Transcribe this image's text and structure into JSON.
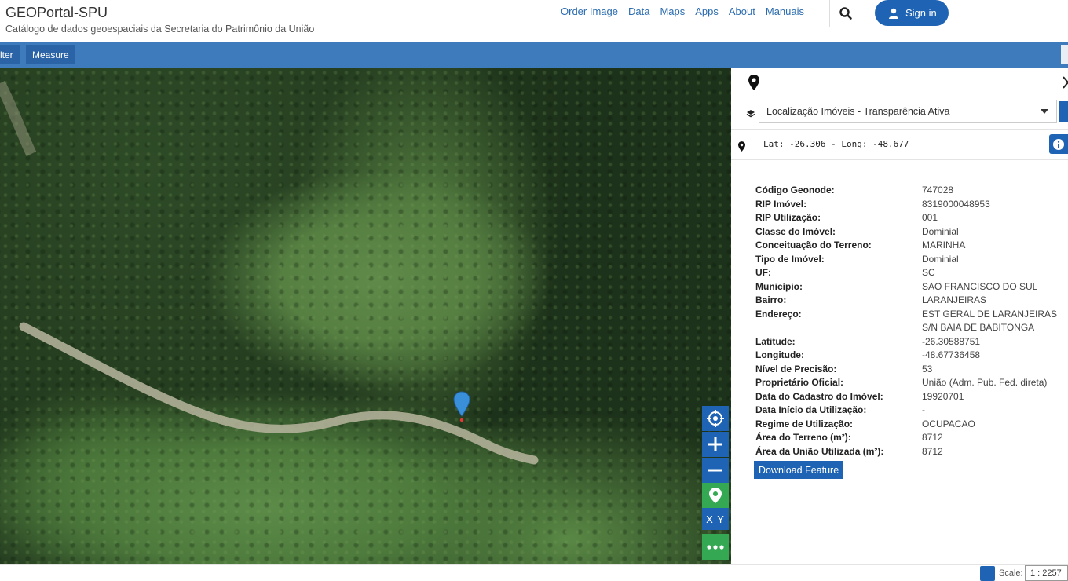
{
  "header": {
    "title": "GEOPortal-SPU",
    "subtitle": "Catálogo de dados geoespaciais da Secretaria do Patrimônio da União",
    "nav": [
      "Order Image",
      "Data",
      "Maps",
      "Apps",
      "About",
      "Manuais"
    ],
    "sign_in": "Sign in"
  },
  "toolbar": {
    "filter_label": "lter",
    "measure_label": "Measure"
  },
  "map_controls": {
    "xy_label": "X Y"
  },
  "panel": {
    "layer": "Localização Imóveis - Transparência Ativa",
    "coords": "Lat: -26.306 - Long: -48.677",
    "attributes": [
      {
        "k": "Código Geonode:",
        "v": "747028"
      },
      {
        "k": "RIP Imóvel:",
        "v": "8319000048953"
      },
      {
        "k": "RIP Utilização:",
        "v": "001"
      },
      {
        "k": "Classe do Imóvel:",
        "v": "Dominial"
      },
      {
        "k": "Conceituação do Terreno:",
        "v": "MARINHA"
      },
      {
        "k": "Tipo de Imóvel:",
        "v": "Dominial"
      },
      {
        "k": "UF:",
        "v": "SC"
      },
      {
        "k": "Município:",
        "v": "SAO FRANCISCO DO SUL"
      },
      {
        "k": "Bairro:",
        "v": "LARANJEIRAS"
      },
      {
        "k": "Endereço:",
        "v": "EST GERAL DE LARANJEIRAS S/N BAIA DE BABITONGA"
      },
      {
        "k": "Latitude:",
        "v": "-26.30588751"
      },
      {
        "k": "Longitude:",
        "v": "-48.67736458"
      },
      {
        "k": "Nível de Precisão:",
        "v": "53"
      },
      {
        "k": "Proprietário Oficial:",
        "v": "União (Adm. Pub. Fed. direta)"
      },
      {
        "k": "Data do Cadastro do Imóvel:",
        "v": "19920701"
      },
      {
        "k": "Data Início da Utilização:",
        "v": "-"
      },
      {
        "k": "Regime de Utilização:",
        "v": "OCUPACAO"
      },
      {
        "k": "Área do Terreno (m²):",
        "v": "8712"
      },
      {
        "k": "Área da União Utilizada (m²):",
        "v": "8712"
      }
    ],
    "download_label": "Download Feature"
  },
  "footer": {
    "scale_label": "Scale:",
    "scale_value": "1 : 2257"
  }
}
